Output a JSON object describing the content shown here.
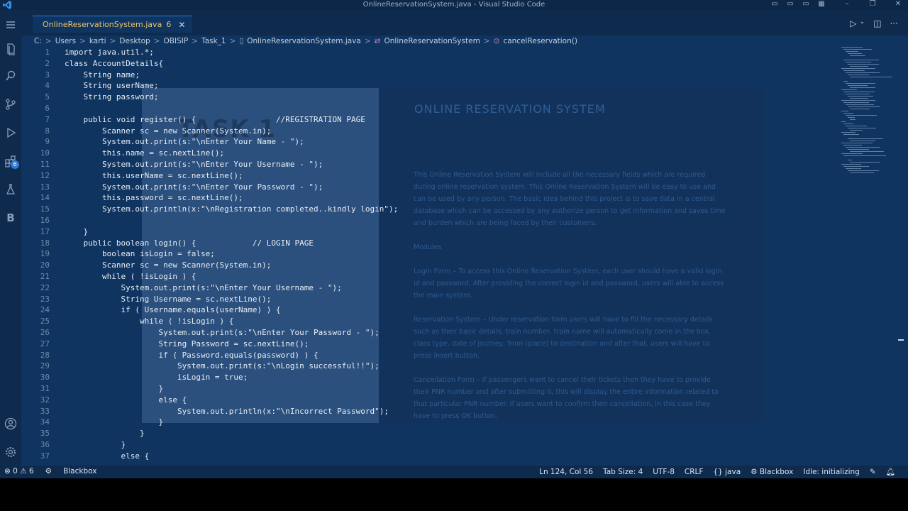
{
  "window": {
    "title": "OnlineReservationSystem.java - Visual Studio Code"
  },
  "tab": {
    "label": "OnlineReservationSystem.java",
    "problems": "6"
  },
  "activity": {
    "extensions_badge": "6",
    "blackbox_letter": "B"
  },
  "breadcrumb": {
    "items": [
      "C:",
      "Users",
      "karti",
      "Desktop",
      "OBISIP",
      "Task_1",
      "OnlineReservationSystem.java",
      "OnlineReservationSystem",
      "cancelReservation()"
    ]
  },
  "overlay": {
    "watermark": "TASK 1",
    "title": "ONLINE RESERVATION SYSTEM",
    "paragraphs": [
      "This Online Reservation System will include all the necessary fields which are required during online reservation system. This Online Reservation System will be easy to use and can be used by any person. The basic idea behind this project is to save data in a central database which can be accessed by any authorize person to get information and saves time and burden which are being faced by their customers.",
      "Modules",
      "Login Form – To access this Online Reservation System, each user should have a valid login id and password. After providing the correct login id and password, users will able to access the main system.",
      "Reservation System – Under reservation form users will have to fill the necessary details such as their basic details, train number, train name will automatically come in the box, class type, date of journey, from (place) to destination and after that, users will have to press insert button.",
      "Cancellation Form – If passengers want to cancel their tickets then they have to provide their PNR number and after submitting it, this will display the entire information related to that particular PNR number. If users want to confirm their cancellation, in this case they have to press OK button."
    ]
  },
  "code": {
    "lines": [
      {
        "n": "1",
        "t": "import java.util.*;"
      },
      {
        "n": "2",
        "t": "class AccountDetails{"
      },
      {
        "n": "3",
        "t": "    String name;"
      },
      {
        "n": "4",
        "t": "    String userName;"
      },
      {
        "n": "5",
        "t": "    String password;"
      },
      {
        "n": "6",
        "t": ""
      },
      {
        "n": "7",
        "t": "    public void register() {                 //REGISTRATION PAGE"
      },
      {
        "n": "8",
        "t": "        Scanner sc = new Scanner(System.in);"
      },
      {
        "n": "9",
        "t": "        System.out.print(s:\"\\nEnter Your Name - \");"
      },
      {
        "n": "10",
        "t": "        this.name = sc.nextLine();"
      },
      {
        "n": "11",
        "t": "        System.out.print(s:\"\\nEnter Your Username - \");"
      },
      {
        "n": "12",
        "t": "        this.userName = sc.nextLine();"
      },
      {
        "n": "13",
        "t": "        System.out.print(s:\"\\nEnter Your Password - \");"
      },
      {
        "n": "14",
        "t": "        this.password = sc.nextLine();"
      },
      {
        "n": "15",
        "t": "        System.out.println(x:\"\\nRegistration completed..kindly login\");"
      },
      {
        "n": "16",
        "t": ""
      },
      {
        "n": "17",
        "t": "    }"
      },
      {
        "n": "18",
        "t": "    public boolean login() {            // LOGIN PAGE"
      },
      {
        "n": "19",
        "t": "        boolean isLogin = false;"
      },
      {
        "n": "20",
        "t": "        Scanner sc = new Scanner(System.in);"
      },
      {
        "n": "21",
        "t": "        while ( !isLogin ) {"
      },
      {
        "n": "22",
        "t": "            System.out.print(s:\"\\nEnter Your Username - \");"
      },
      {
        "n": "23",
        "t": "            String Username = sc.nextLine();"
      },
      {
        "n": "24",
        "t": "            if ( Username.equals(userName) ) {"
      },
      {
        "n": "25",
        "t": "                while ( !isLogin ) {"
      },
      {
        "n": "26",
        "t": "                    System.out.print(s:\"\\nEnter Your Password - \");"
      },
      {
        "n": "27",
        "t": "                    String Password = sc.nextLine();"
      },
      {
        "n": "28",
        "t": "                    if ( Password.equals(password) ) {"
      },
      {
        "n": "29",
        "t": "                        System.out.print(s:\"\\nLogin successful!!\");"
      },
      {
        "n": "30",
        "t": "                        isLogin = true;"
      },
      {
        "n": "31",
        "t": "                    }"
      },
      {
        "n": "32",
        "t": "                    else {"
      },
      {
        "n": "33",
        "t": "                        System.out.println(x:\"\\nIncorrect Password\");"
      },
      {
        "n": "34",
        "t": "                    }"
      },
      {
        "n": "35",
        "t": "                }"
      },
      {
        "n": "36",
        "t": "            }"
      },
      {
        "n": "37",
        "t": "            else {"
      }
    ]
  },
  "status": {
    "errors": "0",
    "warnings": "6",
    "blackbox_left": "Blackbox",
    "position": "Ln 124, Col 56",
    "tab_size": "Tab Size: 4",
    "encoding": "UTF-8",
    "eol": "CRLF",
    "language": "java",
    "blackbox_right": "Blackbox",
    "idle": "Idle: initializing"
  },
  "colors": {
    "editor_bg": "#0f3460",
    "chrome_bg": "#0e2a4d",
    "accent": "#2d7bd6"
  }
}
